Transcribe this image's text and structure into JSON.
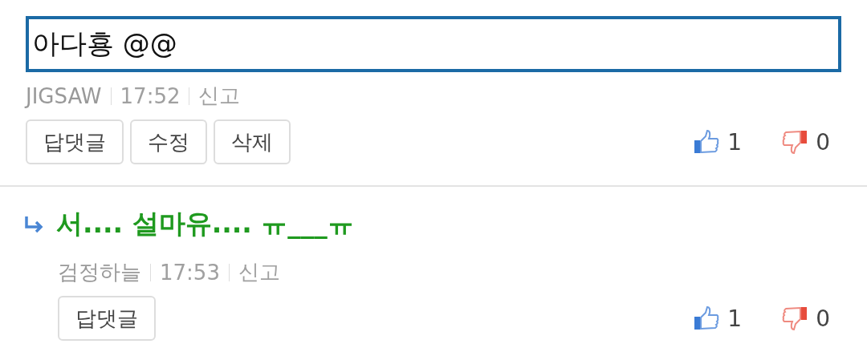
{
  "comments": [
    {
      "kind": "editing",
      "text": "아다횽 @@",
      "author": "JIGSAW",
      "time": "17:52",
      "report": "신고",
      "buttons": [
        "답댓글",
        "수정",
        "삭제"
      ],
      "likes": "1",
      "dislikes": "0"
    },
    {
      "kind": "reply",
      "text": "서.... 설마유.... ㅠ___ㅠ",
      "author": "검정하늘",
      "time": "17:53",
      "report": "신고",
      "buttons": [
        "답댓글"
      ],
      "likes": "1",
      "dislikes": "0"
    }
  ]
}
